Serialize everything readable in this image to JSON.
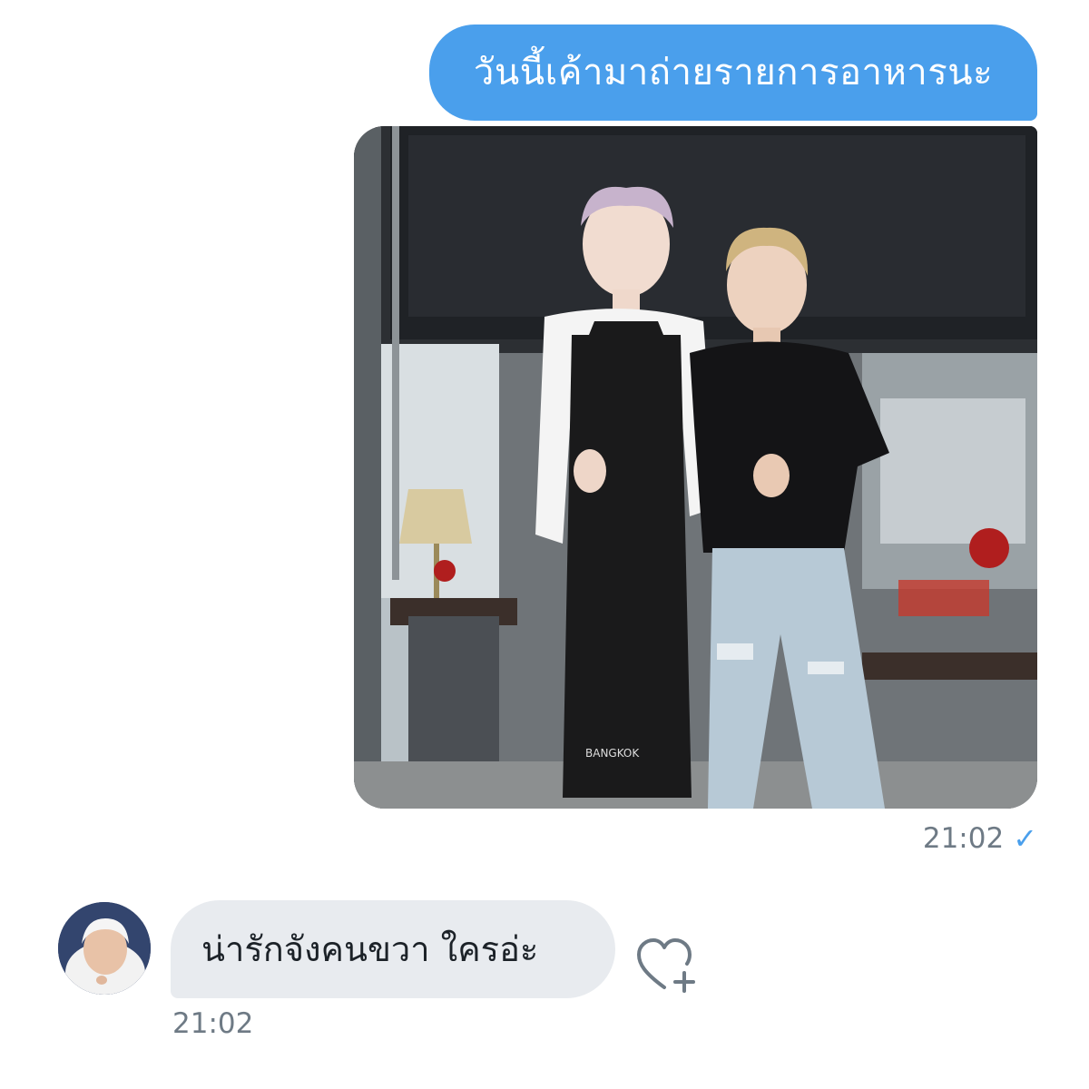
{
  "outgoing": {
    "text": "วันนี้เค้ามาถ่ายรายการอาหารนะ",
    "photo": {
      "apron_print": "BANGKOK"
    },
    "time": "21:02",
    "status_icon": "checkmark-icon"
  },
  "incoming": {
    "text": "น่ารักจังคนขวา ใครอ่ะ",
    "time": "21:02",
    "avatar_icon": "avatar",
    "reaction_icon": "add-reaction-heart-icon"
  },
  "colors": {
    "outgoing_bubble": "#4a9fec",
    "incoming_bubble": "#e8ebef",
    "timestamp": "#6e7a85",
    "check": "#4a9fec"
  }
}
